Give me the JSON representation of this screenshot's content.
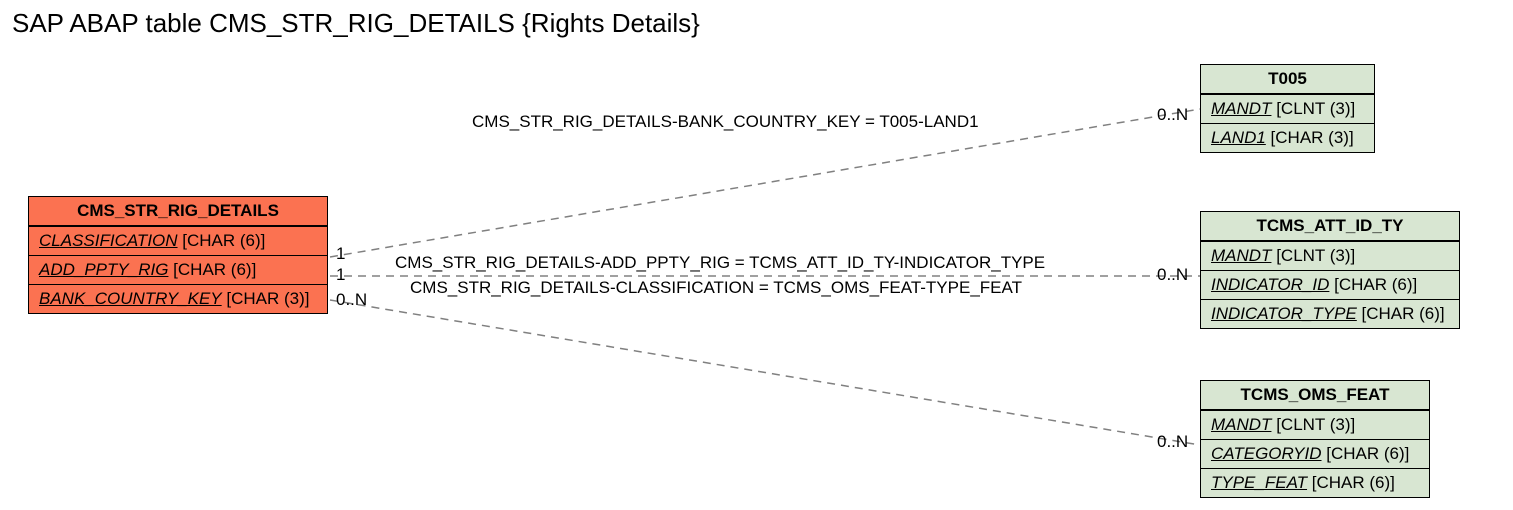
{
  "title": "SAP ABAP table CMS_STR_RIG_DETAILS {Rights Details}",
  "main_table": {
    "name": "CMS_STR_RIG_DETAILS",
    "fields": [
      {
        "name": "CLASSIFICATION",
        "type": "[CHAR (6)]"
      },
      {
        "name": "ADD_PPTY_RIG",
        "type": "[CHAR (6)]"
      },
      {
        "name": "BANK_COUNTRY_KEY",
        "type": "[CHAR (3)]"
      }
    ]
  },
  "t005": {
    "name": "T005",
    "fields": [
      {
        "name": "MANDT",
        "type": "[CLNT (3)]"
      },
      {
        "name": "LAND1",
        "type": "[CHAR (3)]"
      }
    ]
  },
  "att": {
    "name": "TCMS_ATT_ID_TY",
    "fields": [
      {
        "name": "MANDT",
        "type": "[CLNT (3)]"
      },
      {
        "name": "INDICATOR_ID",
        "type": "[CHAR (6)]"
      },
      {
        "name": "INDICATOR_TYPE",
        "type": "[CHAR (6)]"
      }
    ]
  },
  "feat": {
    "name": "TCMS_OMS_FEAT",
    "fields": [
      {
        "name": "MANDT",
        "type": "[CLNT (3)]"
      },
      {
        "name": "CATEGORYID",
        "type": "[CHAR (6)]"
      },
      {
        "name": "TYPE_FEAT",
        "type": "[CHAR (6)]"
      }
    ]
  },
  "relations": {
    "r1": {
      "label": "CMS_STR_RIG_DETAILS-BANK_COUNTRY_KEY = T005-LAND1",
      "src_card": "1",
      "dst_card": "0..N"
    },
    "r2": {
      "label": "CMS_STR_RIG_DETAILS-ADD_PPTY_RIG = TCMS_ATT_ID_TY-INDICATOR_TYPE",
      "src_card": "1",
      "dst_card": "0..N"
    },
    "r3": {
      "label": "CMS_STR_RIG_DETAILS-CLASSIFICATION = TCMS_OMS_FEAT-TYPE_FEAT",
      "src_card": "0..N",
      "dst_card": "0..N"
    }
  }
}
